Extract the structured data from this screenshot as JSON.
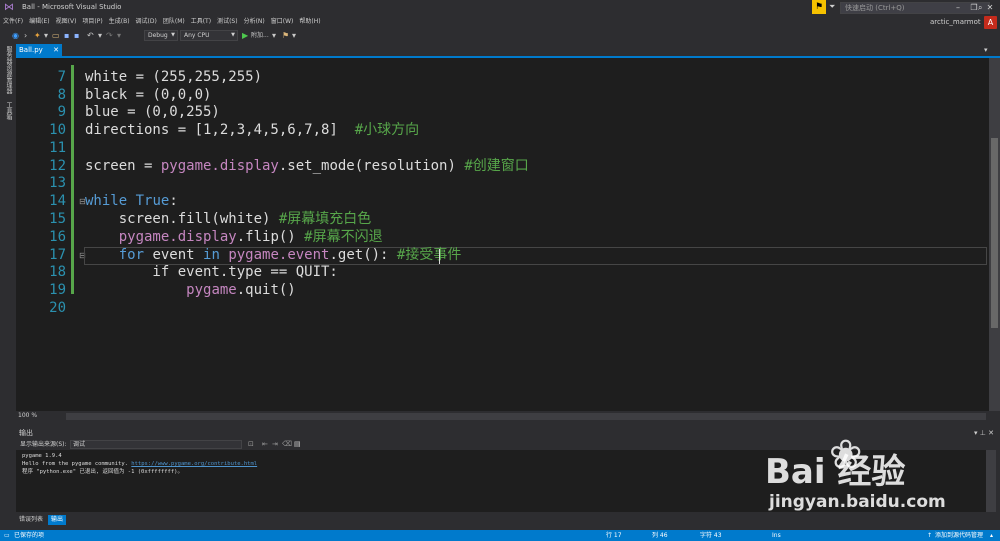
{
  "window": {
    "title": "Ball - Microsoft Visual Studio",
    "quick_launch_placeholder": "快速启动 (Ctrl+Q)",
    "user_name": "arctic_marmot",
    "avatar_letter": "A"
  },
  "menu": [
    "文件(F)",
    "编辑(E)",
    "视图(V)",
    "项目(P)",
    "生成(B)",
    "调试(D)",
    "团队(M)",
    "工具(T)",
    "测试(S)",
    "分析(N)",
    "窗口(W)",
    "帮助(H)"
  ],
  "toolbar": {
    "config": "Debug",
    "platform": "Any CPU",
    "start_label": "附加..."
  },
  "side_rail": {
    "server_explorer": "服务器资源管理器",
    "toolbox": "工具箱"
  },
  "document": {
    "tab_label": "Ball.py",
    "zoom": "100 %",
    "lines": [
      {
        "num": "7",
        "text": "white = (255,255,255)"
      },
      {
        "num": "8",
        "text": "black = (0,0,0)"
      },
      {
        "num": "9",
        "text": "blue = (0,0,255)"
      },
      {
        "num": "10",
        "text": "directions = [1,2,3,4,5,6,7,8]  ",
        "comment": "#小球方向"
      },
      {
        "num": "11",
        "text": ""
      },
      {
        "num": "12",
        "text": "screen = ",
        "call": "pygame.display",
        "text2": ".set_mode(resolution) ",
        "comment": "#创建窗口"
      },
      {
        "num": "13",
        "text": ""
      },
      {
        "num": "14",
        "kw": "while",
        "text": " ",
        "kw2": "True",
        "text2": ":"
      },
      {
        "num": "15",
        "text": "    screen.fill(white) ",
        "comment": "#屏幕填充白色"
      },
      {
        "num": "16",
        "text": "    ",
        "call": "pygame.display",
        "text2": ".flip() ",
        "comment": "#屏幕不闪退"
      },
      {
        "num": "17",
        "text": "    "
      },
      {
        "num": "18",
        "text": "        if event.type == QUIT:"
      },
      {
        "num": "19",
        "text": "            ",
        "call": "pygame",
        "text2": ".quit()"
      },
      {
        "num": "20",
        "text": ""
      }
    ],
    "line17": {
      "kw": "for",
      "t1": " event ",
      "kw2": "in",
      "t2": " ",
      "call": "pygame.event",
      "t3": ".get(): ",
      "comment": "#接受事件"
    }
  },
  "output": {
    "title": "输出",
    "source_label": "显示输出来源(S):",
    "source_value": "调试",
    "lines": [
      "pygame 1.9.4",
      "Hello from the pygame community. ",
      "程序 \"python.exe\" 已退出, 返回值为 -1 (0xffffffff)。"
    ],
    "link": "https://www.pygame.org/contribute.html"
  },
  "bottom_tabs": [
    "错误列表",
    "输出"
  ],
  "status": {
    "message": "已保存的项",
    "line": "行 17",
    "col": "列 46",
    "char": "字符 43",
    "mode": "Ins",
    "source_control": "添加到源代码管理"
  },
  "watermark": {
    "logo": "Bai  经验",
    "url": "jingyan.baidu.com"
  }
}
